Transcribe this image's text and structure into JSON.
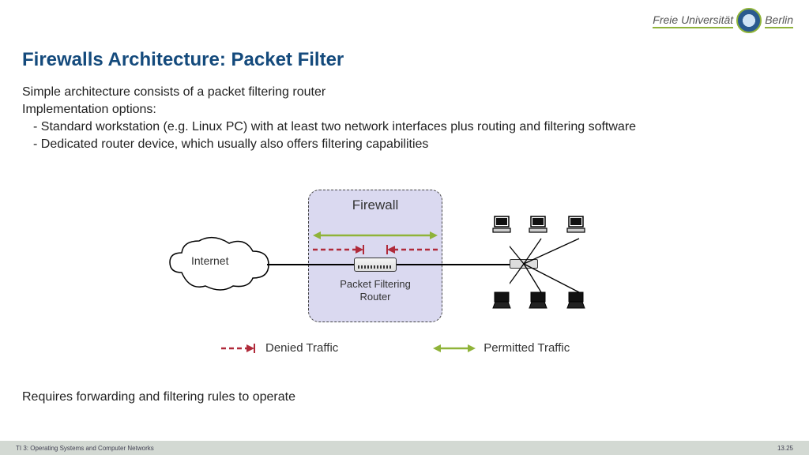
{
  "header": {
    "logo_left": "Freie Universität",
    "logo_right": "Berlin"
  },
  "title": "Firewalls Architecture: Packet Filter",
  "body": {
    "line1": "Simple architecture consists of a packet filtering router",
    "line2": "Implementation options:",
    "bullet1": "Standard workstation (e.g. Linux PC) with at least two network interfaces plus routing and filtering software",
    "bullet2": "Dedicated router device, which usually also offers filtering capabilities",
    "bottom": "Requires forwarding and filtering rules to operate"
  },
  "diagram": {
    "firewall_label": "Firewall",
    "internet_label": "Internet",
    "router_label_l1": "Packet Filtering",
    "router_label_l2": "Router"
  },
  "legend": {
    "denied": "Denied Traffic",
    "permitted": "Permitted Traffic"
  },
  "footer": {
    "left": "TI 3: Operating Systems and Computer Networks",
    "right": "13.25"
  }
}
